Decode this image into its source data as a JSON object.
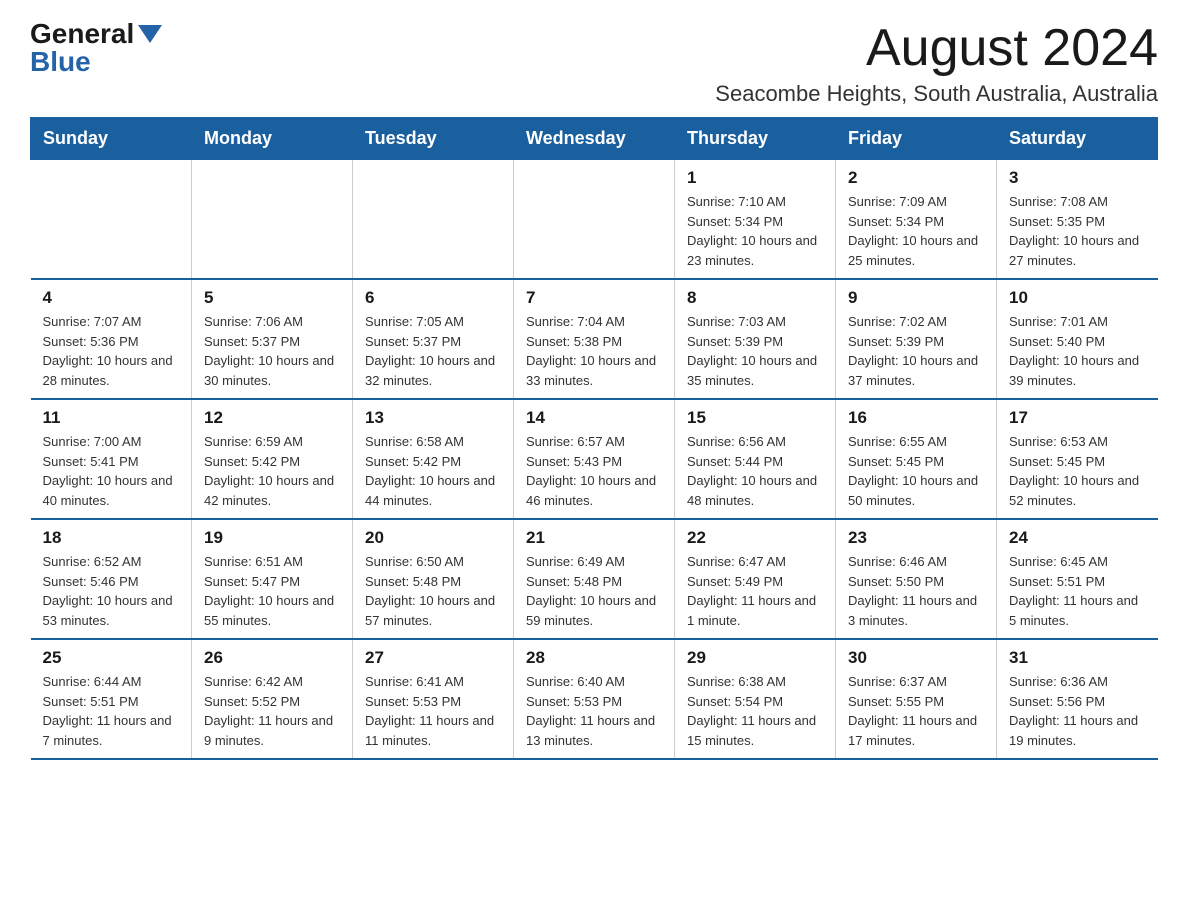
{
  "logo": {
    "general": "General",
    "blue": "Blue"
  },
  "header": {
    "month_title": "August 2024",
    "subtitle": "Seacombe Heights, South Australia, Australia"
  },
  "calendar": {
    "days_of_week": [
      "Sunday",
      "Monday",
      "Tuesday",
      "Wednesday",
      "Thursday",
      "Friday",
      "Saturday"
    ],
    "weeks": [
      [
        {
          "day": "",
          "info": ""
        },
        {
          "day": "",
          "info": ""
        },
        {
          "day": "",
          "info": ""
        },
        {
          "day": "",
          "info": ""
        },
        {
          "day": "1",
          "info": "Sunrise: 7:10 AM\nSunset: 5:34 PM\nDaylight: 10 hours and 23 minutes."
        },
        {
          "day": "2",
          "info": "Sunrise: 7:09 AM\nSunset: 5:34 PM\nDaylight: 10 hours and 25 minutes."
        },
        {
          "day": "3",
          "info": "Sunrise: 7:08 AM\nSunset: 5:35 PM\nDaylight: 10 hours and 27 minutes."
        }
      ],
      [
        {
          "day": "4",
          "info": "Sunrise: 7:07 AM\nSunset: 5:36 PM\nDaylight: 10 hours and 28 minutes."
        },
        {
          "day": "5",
          "info": "Sunrise: 7:06 AM\nSunset: 5:37 PM\nDaylight: 10 hours and 30 minutes."
        },
        {
          "day": "6",
          "info": "Sunrise: 7:05 AM\nSunset: 5:37 PM\nDaylight: 10 hours and 32 minutes."
        },
        {
          "day": "7",
          "info": "Sunrise: 7:04 AM\nSunset: 5:38 PM\nDaylight: 10 hours and 33 minutes."
        },
        {
          "day": "8",
          "info": "Sunrise: 7:03 AM\nSunset: 5:39 PM\nDaylight: 10 hours and 35 minutes."
        },
        {
          "day": "9",
          "info": "Sunrise: 7:02 AM\nSunset: 5:39 PM\nDaylight: 10 hours and 37 minutes."
        },
        {
          "day": "10",
          "info": "Sunrise: 7:01 AM\nSunset: 5:40 PM\nDaylight: 10 hours and 39 minutes."
        }
      ],
      [
        {
          "day": "11",
          "info": "Sunrise: 7:00 AM\nSunset: 5:41 PM\nDaylight: 10 hours and 40 minutes."
        },
        {
          "day": "12",
          "info": "Sunrise: 6:59 AM\nSunset: 5:42 PM\nDaylight: 10 hours and 42 minutes."
        },
        {
          "day": "13",
          "info": "Sunrise: 6:58 AM\nSunset: 5:42 PM\nDaylight: 10 hours and 44 minutes."
        },
        {
          "day": "14",
          "info": "Sunrise: 6:57 AM\nSunset: 5:43 PM\nDaylight: 10 hours and 46 minutes."
        },
        {
          "day": "15",
          "info": "Sunrise: 6:56 AM\nSunset: 5:44 PM\nDaylight: 10 hours and 48 minutes."
        },
        {
          "day": "16",
          "info": "Sunrise: 6:55 AM\nSunset: 5:45 PM\nDaylight: 10 hours and 50 minutes."
        },
        {
          "day": "17",
          "info": "Sunrise: 6:53 AM\nSunset: 5:45 PM\nDaylight: 10 hours and 52 minutes."
        }
      ],
      [
        {
          "day": "18",
          "info": "Sunrise: 6:52 AM\nSunset: 5:46 PM\nDaylight: 10 hours and 53 minutes."
        },
        {
          "day": "19",
          "info": "Sunrise: 6:51 AM\nSunset: 5:47 PM\nDaylight: 10 hours and 55 minutes."
        },
        {
          "day": "20",
          "info": "Sunrise: 6:50 AM\nSunset: 5:48 PM\nDaylight: 10 hours and 57 minutes."
        },
        {
          "day": "21",
          "info": "Sunrise: 6:49 AM\nSunset: 5:48 PM\nDaylight: 10 hours and 59 minutes."
        },
        {
          "day": "22",
          "info": "Sunrise: 6:47 AM\nSunset: 5:49 PM\nDaylight: 11 hours and 1 minute."
        },
        {
          "day": "23",
          "info": "Sunrise: 6:46 AM\nSunset: 5:50 PM\nDaylight: 11 hours and 3 minutes."
        },
        {
          "day": "24",
          "info": "Sunrise: 6:45 AM\nSunset: 5:51 PM\nDaylight: 11 hours and 5 minutes."
        }
      ],
      [
        {
          "day": "25",
          "info": "Sunrise: 6:44 AM\nSunset: 5:51 PM\nDaylight: 11 hours and 7 minutes."
        },
        {
          "day": "26",
          "info": "Sunrise: 6:42 AM\nSunset: 5:52 PM\nDaylight: 11 hours and 9 minutes."
        },
        {
          "day": "27",
          "info": "Sunrise: 6:41 AM\nSunset: 5:53 PM\nDaylight: 11 hours and 11 minutes."
        },
        {
          "day": "28",
          "info": "Sunrise: 6:40 AM\nSunset: 5:53 PM\nDaylight: 11 hours and 13 minutes."
        },
        {
          "day": "29",
          "info": "Sunrise: 6:38 AM\nSunset: 5:54 PM\nDaylight: 11 hours and 15 minutes."
        },
        {
          "day": "30",
          "info": "Sunrise: 6:37 AM\nSunset: 5:55 PM\nDaylight: 11 hours and 17 minutes."
        },
        {
          "day": "31",
          "info": "Sunrise: 6:36 AM\nSunset: 5:56 PM\nDaylight: 11 hours and 19 minutes."
        }
      ]
    ]
  }
}
